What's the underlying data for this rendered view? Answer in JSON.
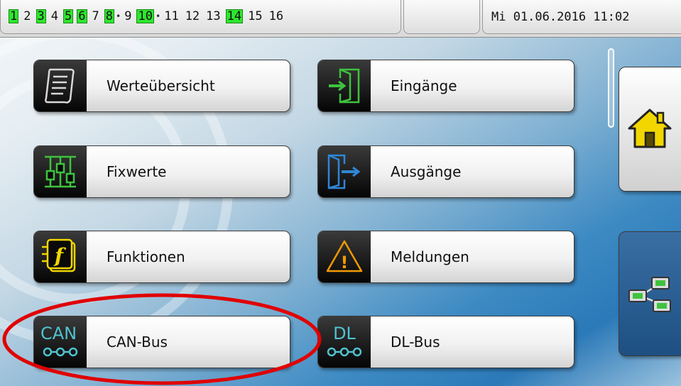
{
  "status_bar": {
    "outputs": [
      {
        "label": "1",
        "active": true
      },
      {
        "label": "2",
        "active": false
      },
      {
        "label": "3",
        "active": true
      },
      {
        "label": "4",
        "active": false
      },
      {
        "label": "5",
        "active": true
      },
      {
        "label": "6",
        "active": true
      },
      {
        "label": "7",
        "active": false
      },
      {
        "label": "8",
        "active": true,
        "dot": true
      },
      {
        "label": "9",
        "active": false
      },
      {
        "label": "10",
        "active": true,
        "dot": true
      },
      {
        "label": "11",
        "active": false
      },
      {
        "label": "12",
        "active": false
      },
      {
        "label": "13",
        "active": false
      },
      {
        "label": "14",
        "active": true
      },
      {
        "label": "15",
        "active": false
      },
      {
        "label": "16",
        "active": false
      }
    ],
    "datetime": "Mi  01.06.2016 11:02"
  },
  "menu": {
    "werte": "Werteübersicht",
    "eingaenge": "Eingänge",
    "fixwerte": "Fixwerte",
    "ausgaenge": "Ausgänge",
    "funktionen": "Funktionen",
    "meldungen": "Meldungen",
    "canbus": "CAN-Bus",
    "dlbus": "DL-Bus"
  },
  "icons": {
    "can_text": "CAN",
    "dl_text": "DL",
    "function_letter": "f",
    "warning_mark": "!"
  },
  "colors": {
    "output_active": "#2ee62e",
    "highlight": "#e00000",
    "can_icon": "#4fc3d0",
    "function_icon": "#f2d600",
    "warning_icon": "#f29a00",
    "input_icon": "#3ec33e",
    "output_icon": "#2f86d6"
  }
}
